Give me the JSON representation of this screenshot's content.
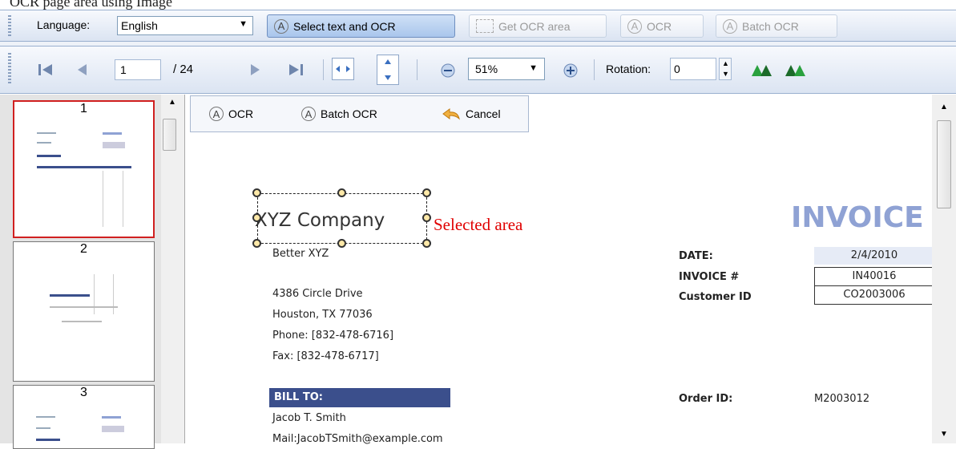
{
  "caption": "OCR page area using Image",
  "toolbar1": {
    "language_label": "Language:",
    "language_value": "English",
    "select_text_ocr_label": "Select text and OCR",
    "get_ocr_area_label": "Get OCR area",
    "ocr_label": "OCR",
    "batch_ocr_label": "Batch OCR",
    "ocr_glyph": "A"
  },
  "toolbar2": {
    "page_value": "1",
    "page_total": "/ 24",
    "zoom_value": "51%",
    "rotation_label": "Rotation:",
    "rotation_value": "0"
  },
  "thumbnails": [
    {
      "number": "1"
    },
    {
      "number": "2"
    },
    {
      "number": "3"
    }
  ],
  "area_toolbar": {
    "ocr_label": "OCR",
    "batch_ocr_label": "Batch OCR",
    "cancel_label": "Cancel"
  },
  "document": {
    "company": "XYZ Company",
    "tagline": "Better XYZ",
    "address1": "4386 Circle Drive",
    "address2": "Houston, TX 77036",
    "phone": "Phone: [832-478-6716]",
    "fax": "Fax: [832-478-6717]",
    "invoice_title": "INVOICE",
    "date_label": "DATE:",
    "date_value": "2/4/2010",
    "invoice_no_label": "INVOICE #",
    "invoice_no_value": "IN40016",
    "customer_id_label": "Customer ID",
    "customer_id_value": "CO2003006",
    "bill_to": "BILL TO:",
    "bill_name": "Jacob T. Smith",
    "bill_mail": "Mail:JacobTSmith@example.com",
    "order_id_label": "Order ID:",
    "order_id_value": "M2003012"
  },
  "selection_label": "Selected area",
  "colors": {
    "selection_label": "#e00000",
    "invoice_title": "#8fa2d4",
    "bill_to_bg": "#3b4f8c",
    "selected_thumb_border": "#d02020"
  }
}
